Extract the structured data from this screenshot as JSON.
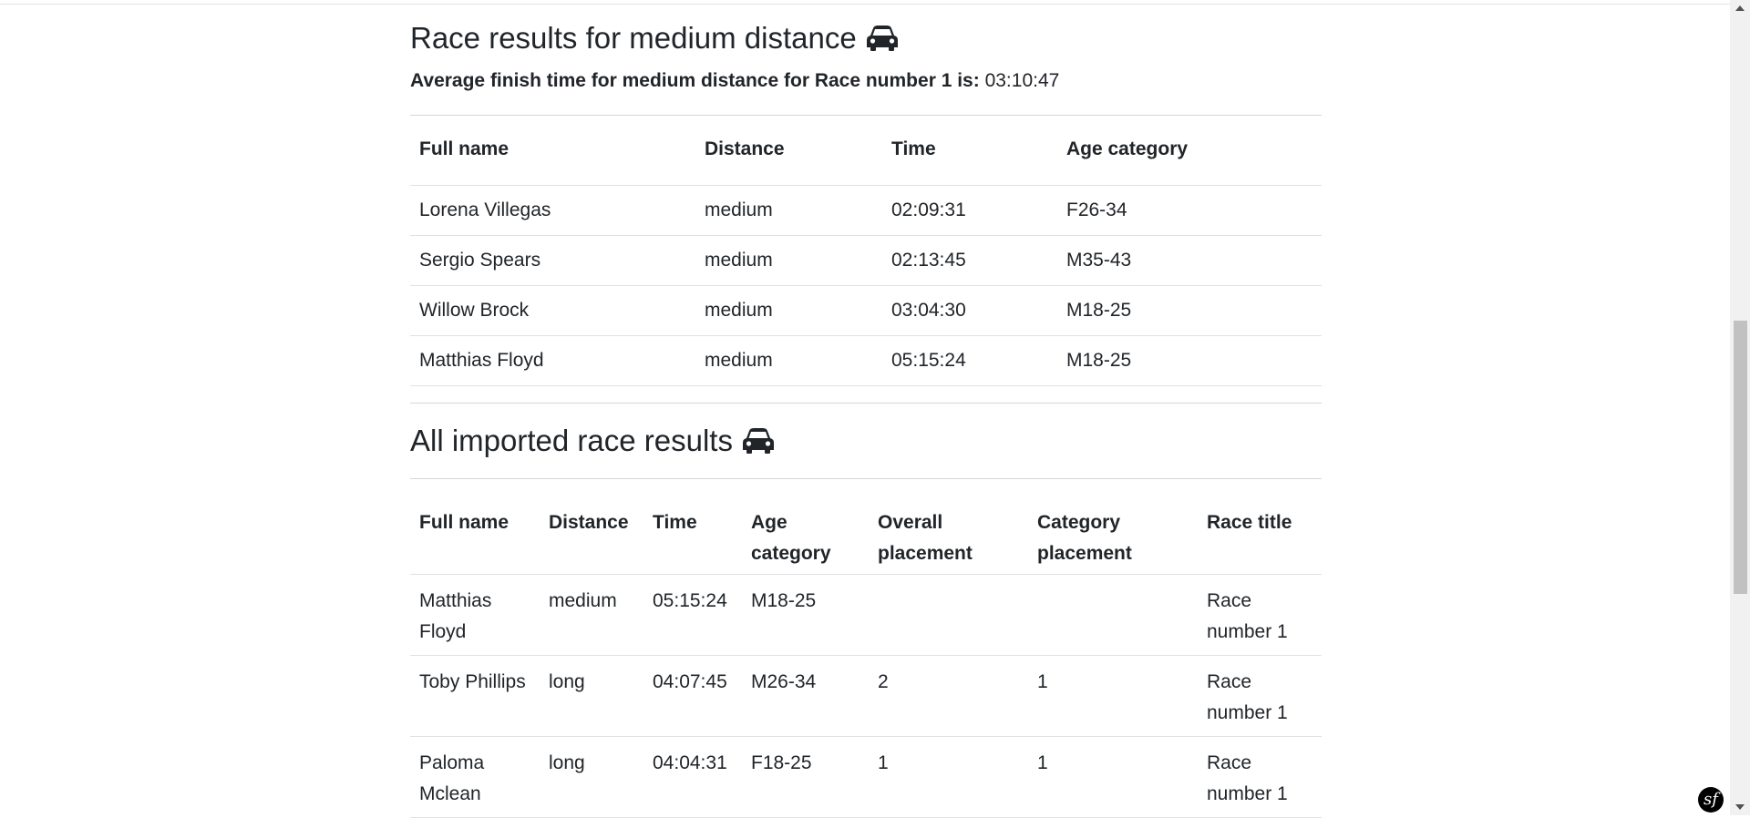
{
  "section1": {
    "title": "Race results for medium distance",
    "avg_label": "Average finish time for medium distance for Race number 1 is:",
    "avg_value": "03:10:47",
    "headers": [
      "Full name",
      "Distance",
      "Time",
      "Age category"
    ],
    "rows": [
      [
        "Lorena Villegas",
        "medium",
        "02:09:31",
        "F26-34"
      ],
      [
        "Sergio Spears",
        "medium",
        "02:13:45",
        "M35-43"
      ],
      [
        "Willow Brock",
        "medium",
        "03:04:30",
        "M18-25"
      ],
      [
        "Matthias Floyd",
        "medium",
        "05:15:24",
        "M18-25"
      ]
    ]
  },
  "section2": {
    "title": "All imported race results",
    "headers": [
      "Full name",
      "Distance",
      "Time",
      "Age category",
      "Overall placement",
      "Category placement",
      "Race title"
    ],
    "rows": [
      [
        "Matthias Floyd",
        "medium",
        "05:15:24",
        "M18-25",
        "",
        "",
        "Race number 1"
      ],
      [
        "Toby Phillips",
        "long",
        "04:07:45",
        "M26-34",
        "2",
        "1",
        "Race number 1"
      ],
      [
        "Paloma Mclean",
        "long",
        "04:04:31",
        "F18-25",
        "1",
        "1",
        "Race number 1"
      ]
    ]
  },
  "icons": {
    "title_icon": "car-icon",
    "debug_toolbar": "symfony-icon"
  },
  "badge_text": "sf"
}
